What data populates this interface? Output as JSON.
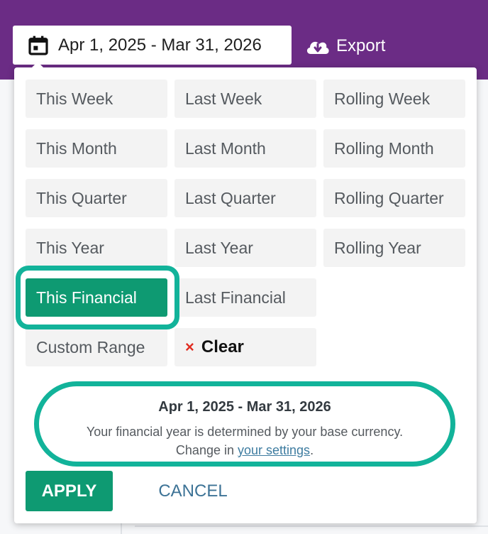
{
  "header": {
    "date_range_label": "Apr 1, 2025 - Mar 31, 2026",
    "export_label": "Export",
    "calendar_icon": "calendar-icon",
    "export_icon": "cloud-download-icon"
  },
  "presets": {
    "this_week": "This Week",
    "last_week": "Last Week",
    "rolling_week": "Rolling Week",
    "this_month": "This Month",
    "last_month": "Last Month",
    "rolling_month": "Rolling Month",
    "this_quarter": "This Quarter",
    "last_quarter": "Last Quarter",
    "rolling_quarter": "Rolling Quarter",
    "this_year": "This Year",
    "last_year": "Last Year",
    "rolling_year": "Rolling Year",
    "this_financial": "This Financial",
    "last_financial": "Last Financial",
    "custom_range": "Custom Range",
    "clear": "Clear",
    "clear_icon": "×",
    "selected": "This Financial"
  },
  "info": {
    "range": "Apr 1, 2025 - Mar 31, 2026",
    "description": "Your financial year is determined by your base currency.",
    "change_prefix": "Change in ",
    "settings_link": "your settings",
    "change_suffix": "."
  },
  "actions": {
    "apply": "APPLY",
    "cancel": "CANCEL"
  },
  "colors": {
    "header_purple": "#6b2c85",
    "selected_green": "#0e9a72",
    "highlight_teal": "#12b39a",
    "link_blue": "#3e7ca0",
    "clear_red": "#e02b20"
  }
}
